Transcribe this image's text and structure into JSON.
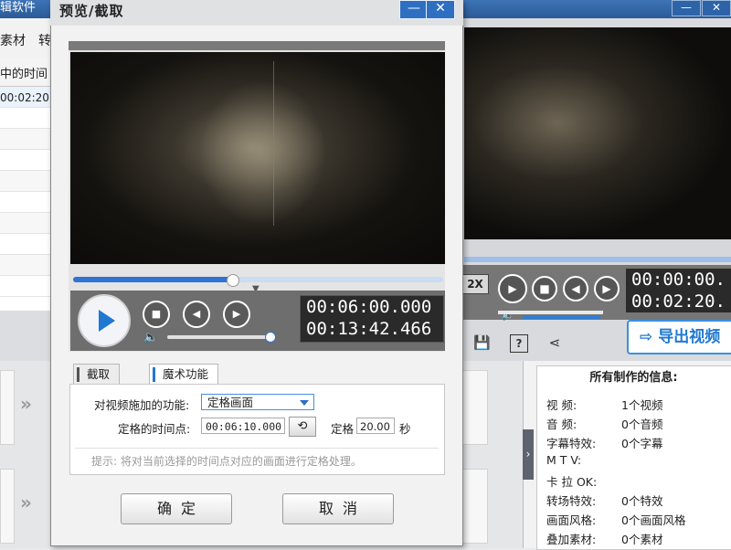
{
  "background_app": {
    "title_fragment": "辑软件",
    "tabs": [
      "素材",
      "转"
    ],
    "list_header": "中的时间",
    "list_first_value": "00:02:20.",
    "window_buttons": [
      "—",
      "✕"
    ],
    "preview": {
      "speed_label": "2X",
      "time_current": "00:00:00.",
      "time_total": "00:02:20.",
      "export_label": "导出视频"
    },
    "info_panel": {
      "title": "所有制作的信息:",
      "rows": [
        {
          "label": "视    频:",
          "value": "1个视频"
        },
        {
          "label": "音    频:",
          "value": "0个音频"
        },
        {
          "label": "字幕特效:",
          "value": "0个字幕"
        },
        {
          "label": "M  T  V:",
          "value": ""
        },
        {
          "label": "卡 拉 OK:",
          "value": ""
        },
        {
          "label": "转场特效:",
          "value": "0个特效"
        },
        {
          "label": "画面风格:",
          "value": "0个画面风格"
        },
        {
          "label": "叠加素材:",
          "value": "0个素材"
        }
      ]
    }
  },
  "dialog": {
    "title": "预览/截取",
    "minimize_glyph": "—",
    "close_glyph": "✕",
    "player": {
      "time_current": "00:06:00.000",
      "time_total": "00:13:42.466",
      "progress_fraction": 0.43,
      "volume_fraction": 0.95
    },
    "tabs": [
      "截取",
      "魔术功能"
    ],
    "active_tab": "魔术功能",
    "form": {
      "function_label": "对视频施加的功能:",
      "function_value": "定格画面",
      "time_label": "定格的时间点:",
      "time_value": "00:06:10.000",
      "freeze_label": "定格",
      "freeze_value": "20.00",
      "freeze_unit": "秒",
      "hint": "提示: 将对当前选择的时间点对应的画面进行定格处理。"
    },
    "buttons": {
      "ok": "确定",
      "cancel": "取消"
    }
  },
  "colors": {
    "accent": "#1f78d1",
    "title_bar": "#2f6fc2"
  }
}
